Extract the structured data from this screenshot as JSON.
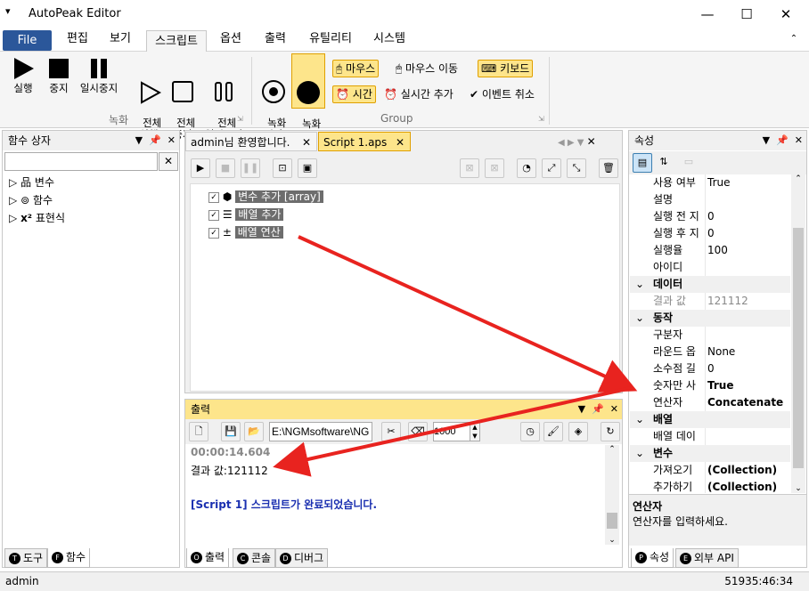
{
  "window": {
    "title": "AutoPeak Editor"
  },
  "menubar": {
    "items": [
      "File",
      "편집",
      "보기",
      "스크립트",
      "옵션",
      "출력",
      "유틸리티",
      "시스템"
    ]
  },
  "ribbon": {
    "record": {
      "run": "실행",
      "stop": "중지",
      "pause": "일시중지",
      "run_all": "전체\n실행",
      "stop_all": "전체\n중지",
      "pause_all": "전체\n일시중지",
      "group": "녹화"
    },
    "group2": {
      "rec_start": "녹화\n시작",
      "rec_stop": "녹화\n중지",
      "mouse": "마우스",
      "mouse_move": "마우스 이동",
      "keyboard": "키보드",
      "time": "시간",
      "realtime_add": "실시간 추가",
      "event_cancel": "이벤트 취소",
      "group": "Group"
    }
  },
  "left_panel": {
    "title": "함수 상자",
    "search_value": "",
    "tree": [
      "변수",
      "함수",
      "표현식"
    ],
    "tabs": [
      "도구",
      "함수"
    ]
  },
  "editor": {
    "tabs": [
      "admin님 환영합니다.",
      "Script 1.aps"
    ],
    "items": [
      {
        "label": "변수 추가 [array]"
      },
      {
        "label": "배열 추가"
      },
      {
        "label": "배열 연산"
      }
    ]
  },
  "output": {
    "title": "출력",
    "path": "E:\\NGMsoftware\\NG",
    "interval": "1000",
    "lines": {
      "time": "00:00:14.604",
      "result": "결과 값:121112",
      "done": "[Script 1] 스크립트가 완료되었습니다."
    },
    "tabs": [
      "출력",
      "콘솔",
      "디버그"
    ]
  },
  "properties": {
    "title": "속성",
    "rows": [
      {
        "type": "row",
        "k": "사용 여부",
        "v": "True"
      },
      {
        "type": "row",
        "k": "설명",
        "v": ""
      },
      {
        "type": "row",
        "k": "실행 전 지",
        "v": "0"
      },
      {
        "type": "row",
        "k": "실행 후 지",
        "v": "0"
      },
      {
        "type": "row",
        "k": "실행율",
        "v": "100"
      },
      {
        "type": "row",
        "k": "아이디",
        "v": ""
      },
      {
        "type": "cat",
        "k": "데이터"
      },
      {
        "type": "row",
        "k": "결과 값",
        "v": "121112",
        "gray": true
      },
      {
        "type": "cat",
        "k": "동작"
      },
      {
        "type": "row",
        "k": "구분자",
        "v": ""
      },
      {
        "type": "row",
        "k": "라운드 옵",
        "v": "None"
      },
      {
        "type": "row",
        "k": "소수점 길",
        "v": "0"
      },
      {
        "type": "row",
        "k": "숫자만 사",
        "v": "True",
        "bold": true
      },
      {
        "type": "row",
        "k": "연산자",
        "v": "Concatenate",
        "bold": true
      },
      {
        "type": "cat",
        "k": "배열"
      },
      {
        "type": "row",
        "k": "배열 데이",
        "v": ""
      },
      {
        "type": "cat",
        "k": "변수"
      },
      {
        "type": "row",
        "k": "가져오기",
        "v": "(Collection)",
        "bold": true
      },
      {
        "type": "row",
        "k": "추가하기",
        "v": "(Collection)",
        "bold": true
      }
    ],
    "desc_title": "연산자",
    "desc_text": "연산자를 입력하세요.",
    "tabs": [
      "속성",
      "외부 API"
    ]
  },
  "status": {
    "user": "admin",
    "clock": "51935:46:34"
  },
  "colors": {
    "accent": "#2b579a",
    "highlight": "#fde58b",
    "arrow": "#e8231f"
  }
}
